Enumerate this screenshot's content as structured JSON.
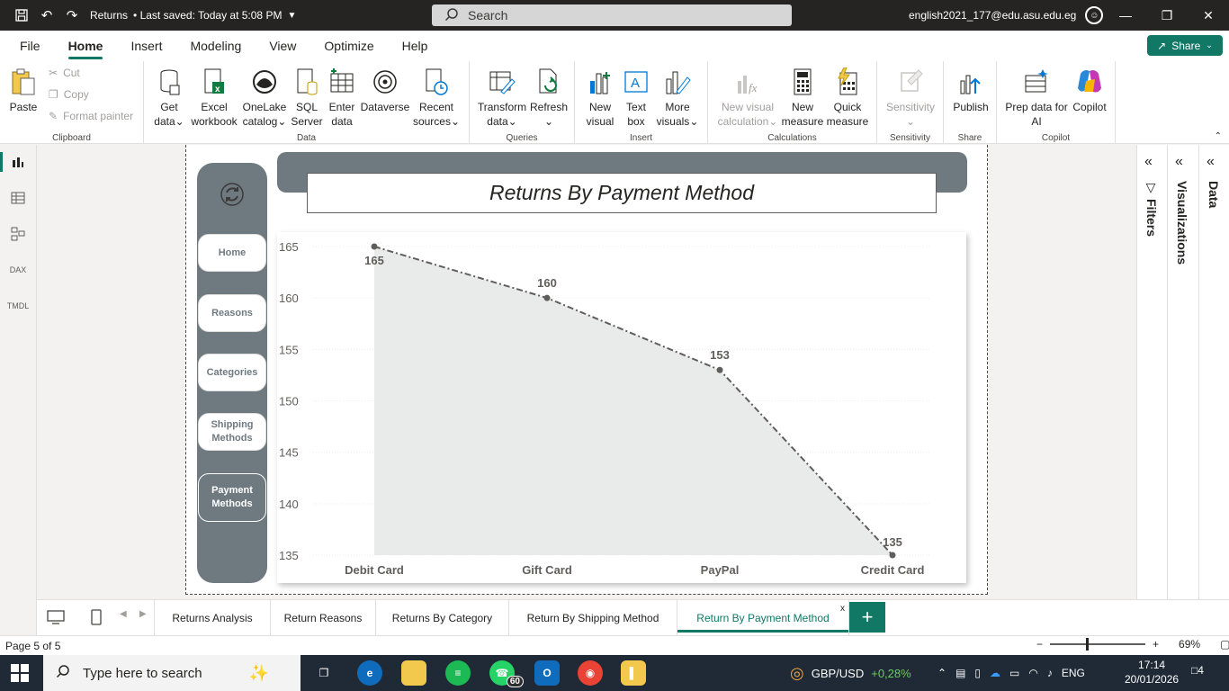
{
  "titlebar": {
    "file_name": "Returns",
    "saved_status": "• Last saved: Today at 5:08 PM",
    "search_label": "Search",
    "account": "english2021_177@edu.asu.edu.eg"
  },
  "menu": {
    "items": [
      "File",
      "Home",
      "Insert",
      "Modeling",
      "View",
      "Optimize",
      "Help"
    ],
    "active": "Home",
    "share_label": "Share"
  },
  "ribbon": {
    "clipboard": {
      "paste": "Paste",
      "cut": "Cut",
      "copy": "Copy",
      "format_painter": "Format painter",
      "label": "Clipboard"
    },
    "data": {
      "get_data": [
        "Get",
        "data"
      ],
      "excel": [
        "Excel",
        "workbook"
      ],
      "onelake": [
        "OneLake",
        "catalog"
      ],
      "sql": [
        "SQL",
        "Server"
      ],
      "enter": [
        "Enter",
        "data"
      ],
      "dataverse": [
        "Dataverse",
        ""
      ],
      "recent": [
        "Recent",
        "sources"
      ],
      "label": "Data"
    },
    "queries": {
      "transform": [
        "Transform",
        "data"
      ],
      "refresh": [
        "Refresh",
        ""
      ],
      "label": "Queries"
    },
    "insert": {
      "new_visual": [
        "New",
        "visual"
      ],
      "text_box": [
        "Text",
        "box"
      ],
      "more_visuals": [
        "More",
        "visuals"
      ],
      "label": "Insert"
    },
    "calculations": {
      "new_visual_calc": [
        "New visual",
        "calculation"
      ],
      "new_measure": [
        "New",
        "measure"
      ],
      "quick_measure": [
        "Quick",
        "measure"
      ],
      "label": "Calculations"
    },
    "sensitivity": {
      "sensitivity": [
        "Sensitivity",
        ""
      ],
      "label": "Sensitivity"
    },
    "share": {
      "publish": [
        "Publish",
        ""
      ],
      "label": "Share"
    },
    "copilot": {
      "prep": [
        "Prep data for",
        "AI"
      ],
      "copilot": [
        "Copilot",
        ""
      ],
      "label": "Copilot"
    }
  },
  "nav": {
    "buttons": [
      "Home",
      "Reasons",
      "Categories",
      "Shipping Methods",
      "Payment Methods"
    ],
    "active": "Payment Methods"
  },
  "report": {
    "title": "Returns By Payment Method"
  },
  "chart_data": {
    "type": "area",
    "title": "Returns By Payment Method",
    "categories": [
      "Debit Card",
      "Gift Card",
      "PayPal",
      "Credit Card"
    ],
    "values": [
      165,
      160,
      153,
      135
    ],
    "ylim": [
      135,
      165
    ],
    "yticks": [
      165,
      160,
      155,
      150,
      145,
      140,
      135
    ],
    "grid": true,
    "line_color": "#605e5c",
    "fill_color": "#e9ebeb"
  },
  "panes": {
    "filters": "Filters",
    "visualizations": "Visualizations",
    "data": "Data"
  },
  "page_tabs": {
    "tabs": [
      "Returns Analysis",
      "Return Reasons",
      "Returns By Category",
      "Return By Shipping Method",
      "Return By Payment Method"
    ],
    "active": "Return By Payment Method",
    "close": "x",
    "add": "+"
  },
  "status": {
    "page": "Page 5 of 5",
    "zoom": "69%"
  },
  "taskbar": {
    "search_placeholder": "Type here to search",
    "whatsapp_badge": "60",
    "weather_label": "GBP/USD",
    "weather_value": "+0,28%",
    "lang": "ENG",
    "time": "17:14",
    "date": "20/01/2026",
    "notifications": "4"
  },
  "colors": {
    "accent": "#117865",
    "nav_panel": "#6f7a80"
  }
}
